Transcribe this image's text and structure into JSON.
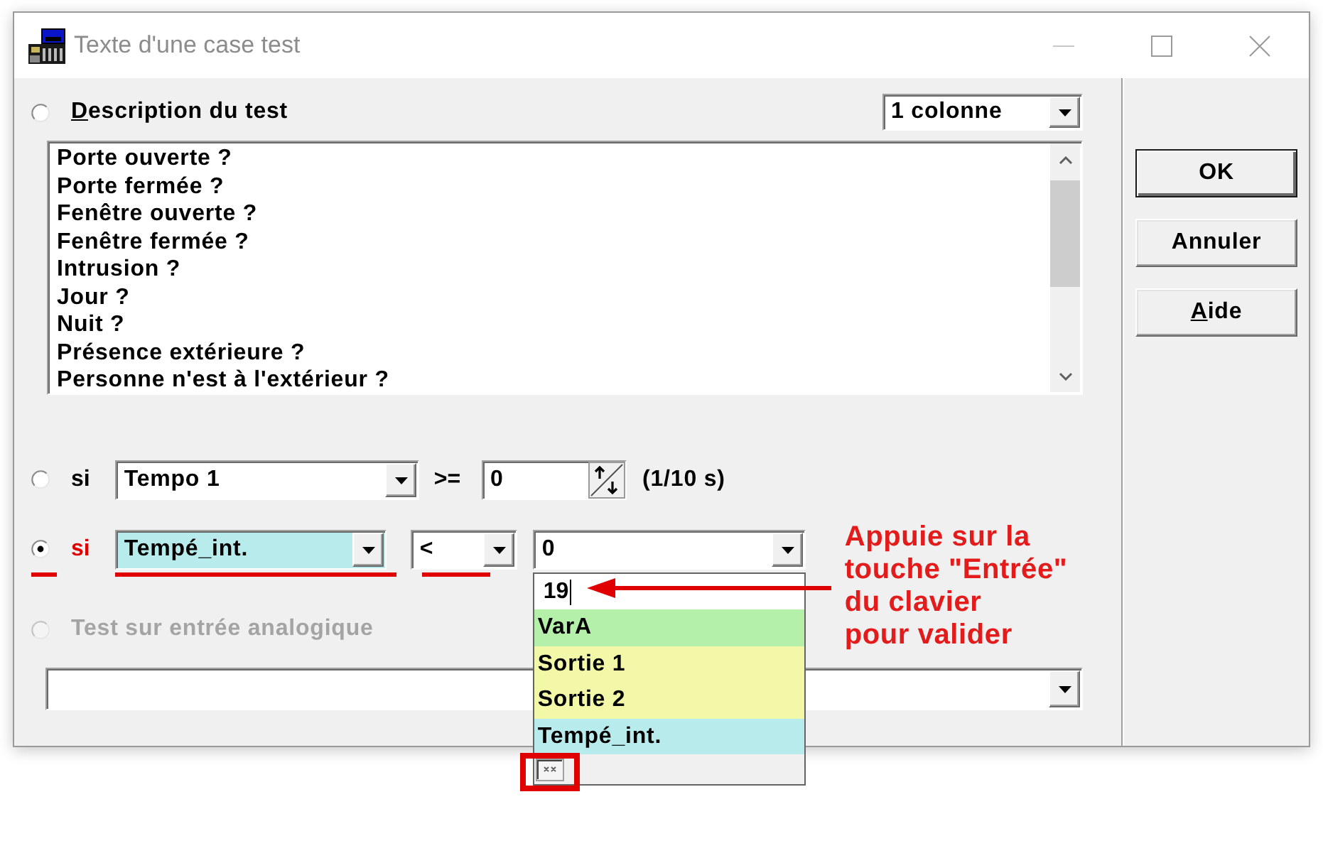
{
  "window": {
    "title": "Texte d'une case test"
  },
  "description": {
    "selected": false,
    "label": "Description du test",
    "mnemonic": true,
    "columns": {
      "value": "1 colonne"
    },
    "list": {
      "items": [
        {
          "label": "Porte ouverte ?",
          "selected": false
        },
        {
          "label": "Porte fermée ?",
          "selected": false
        },
        {
          "label": "Fenêtre ouverte ?",
          "selected": false
        },
        {
          "label": "Fenêtre fermée ?",
          "selected": false
        },
        {
          "label": "Intrusion ?",
          "selected": false
        },
        {
          "label": "Jour ?",
          "selected": false
        },
        {
          "label": "Nuit ?",
          "selected": false
        },
        {
          "label": "Présence extérieure ?",
          "selected": false
        },
        {
          "label": "Personne n'est à l'extérieur ?",
          "selected": false
        }
      ]
    }
  },
  "conditions": [
    {
      "kind": "timer",
      "selected": false,
      "label": "si",
      "source": {
        "value": "Tempo 1"
      },
      "operator": ">=",
      "value": "0",
      "unit": "(1/10 s)"
    },
    {
      "kind": "compare",
      "selected": true,
      "underlined": true,
      "label": "si",
      "source": {
        "value": "Tempé_int.",
        "color": "#b8ecec",
        "underlined": true
      },
      "operator": {
        "value": "<",
        "underlined": true
      },
      "value": {
        "value": "0",
        "expanded": true,
        "dropdown": {
          "input": "19",
          "focused": true,
          "items": [
            {
              "label": "VarA",
              "color": "#b4f0aa",
              "selected": false
            },
            {
              "label": "Sortie 1",
              "color": "#f2f8a8",
              "selected": false
            },
            {
              "label": "Sortie 2",
              "color": "#f2f8a8",
              "selected": false
            },
            {
              "label": "Tempé_int.",
              "color": "#b8ecec",
              "selected": false
            }
          ],
          "footer_highlighted": true
        }
      },
      "annotation": {
        "text": "Appuie sur la\ntouche \"Entrée\"\ndu clavier\npour valider"
      }
    }
  ],
  "analog": {
    "selected": false,
    "disabled": true,
    "label": "Test sur entrée analogique"
  },
  "buttons": [
    {
      "label": "OK",
      "default": true,
      "mnemonic": false
    },
    {
      "label": "Annuler",
      "default": false,
      "mnemonic": false
    },
    {
      "label": "Aide",
      "default": false,
      "mnemonic": true
    }
  ]
}
